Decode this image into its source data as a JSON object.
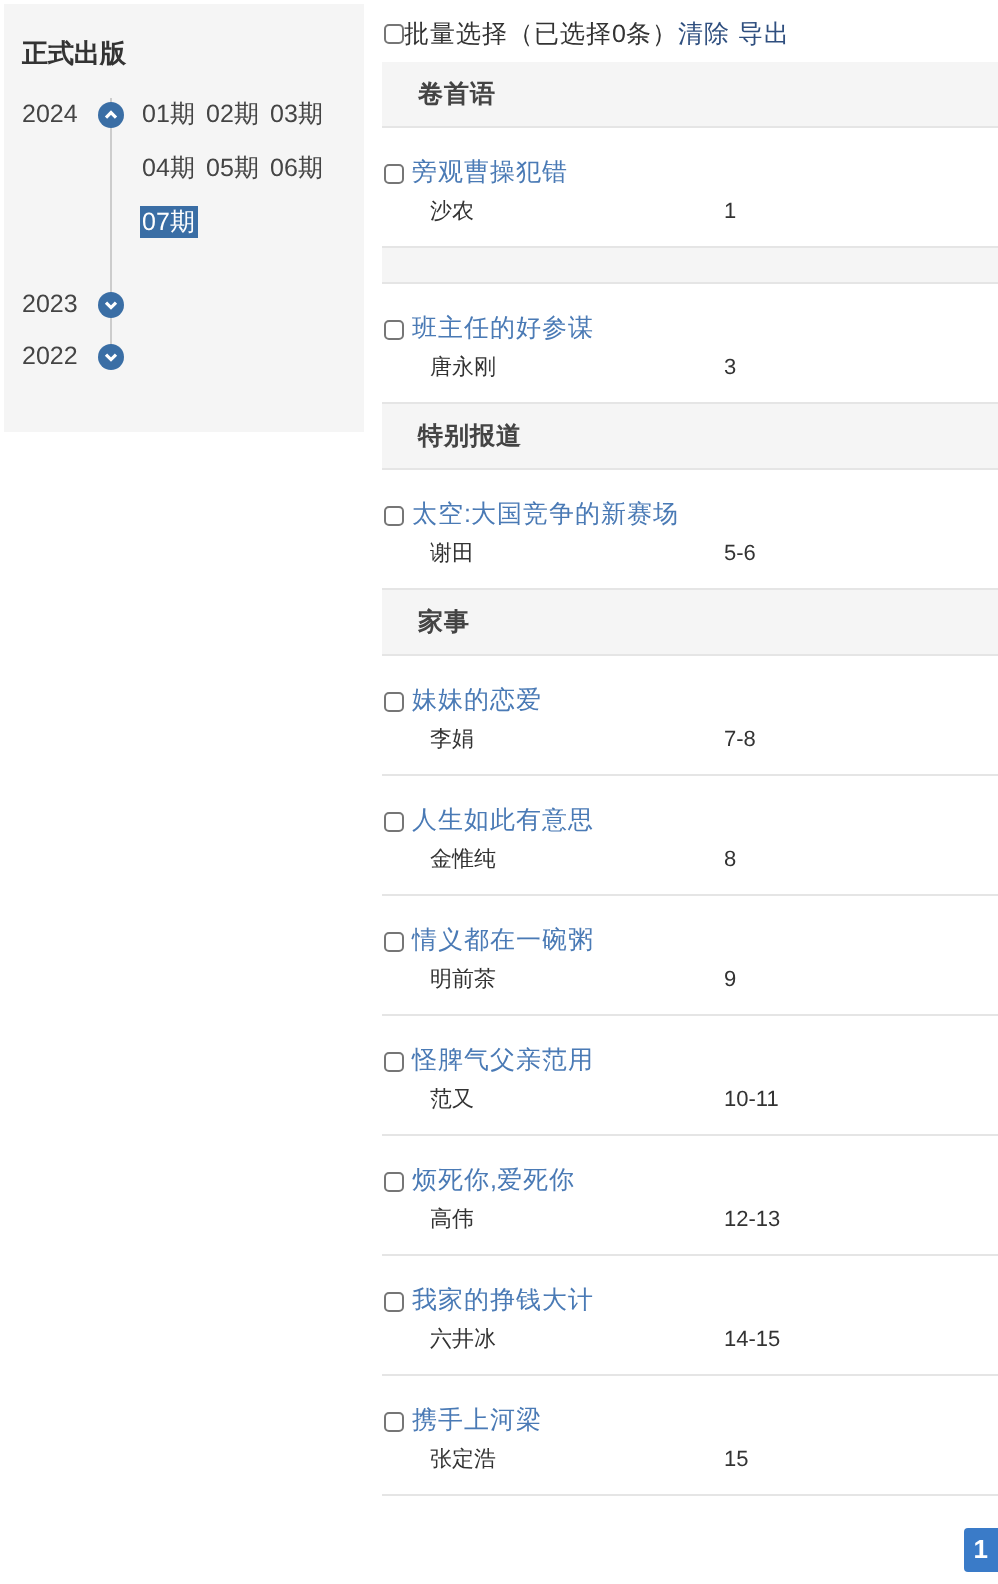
{
  "sidebar": {
    "title": "正式出版",
    "years": [
      {
        "year": "2024",
        "expanded": true,
        "issues": [
          {
            "label": "01期",
            "selected": false
          },
          {
            "label": "02期",
            "selected": false
          },
          {
            "label": "03期",
            "selected": false
          },
          {
            "label": "04期",
            "selected": false
          },
          {
            "label": "05期",
            "selected": false
          },
          {
            "label": "06期",
            "selected": false
          },
          {
            "label": "07期",
            "selected": true
          }
        ]
      },
      {
        "year": "2023",
        "expanded": false
      },
      {
        "year": "2022",
        "expanded": false
      }
    ]
  },
  "toolbar": {
    "select_all": {
      "label": "批量选择",
      "checked": false
    },
    "count": "（已选择0条）",
    "actions": [
      "清除",
      "导出"
    ]
  },
  "sections": [
    {
      "title": "卷首语",
      "articles": [
        {
          "title": "旁观曹操犯错",
          "author": "沙农",
          "pages": "1",
          "checked": false
        }
      ]
    },
    {
      "articles": [
        {
          "title": "班主任的好参谋",
          "author": "唐永刚",
          "pages": "3",
          "checked": false
        }
      ]
    },
    {
      "title": "特别报道",
      "articles": [
        {
          "title": "太空:大国竞争的新赛场",
          "author": "谢田",
          "pages": "5-6",
          "checked": false
        }
      ]
    },
    {
      "title": "家事",
      "articles": [
        {
          "title": "妹妹的恋爱",
          "author": "李娟",
          "pages": "7-8",
          "checked": false
        },
        {
          "title": "人生如此有意思",
          "author": "金惟纯",
          "pages": "8",
          "checked": false
        },
        {
          "title": "情义都在一碗粥",
          "author": "明前茶",
          "pages": "9",
          "checked": false
        },
        {
          "title": "怪脾气父亲范用",
          "author": "范又",
          "pages": "10-11",
          "checked": false
        },
        {
          "title": "烦死你,爱死你",
          "author": "高伟",
          "pages": "12-13",
          "checked": false
        },
        {
          "title": "我家的挣钱大计",
          "author": "六井冰",
          "pages": "14-15",
          "checked": false
        },
        {
          "title": "携手上河梁",
          "author": "张定浩",
          "pages": "15",
          "checked": false
        }
      ]
    }
  ],
  "pagination": [
    {
      "label": "1",
      "selected": true
    }
  ]
}
